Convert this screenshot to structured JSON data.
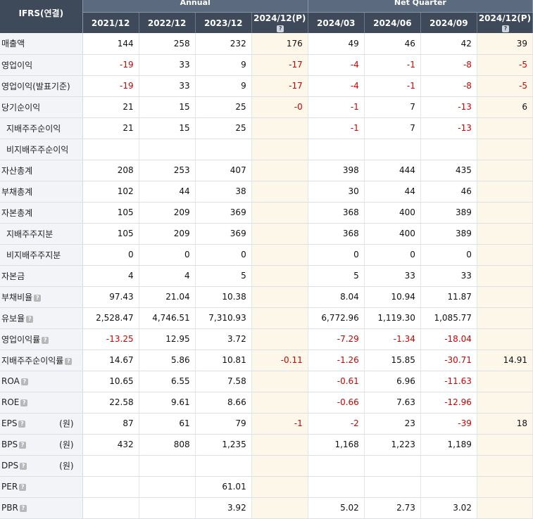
{
  "header": {
    "corner_label": "IFRS(연결)",
    "annual_label": "Annual",
    "quarter_label": "Net Quarter",
    "help_glyph": "?",
    "columns": [
      "2021/12",
      "2022/12",
      "2023/12",
      "2024/12(P)",
      "2024/03",
      "2024/06",
      "2024/09",
      "2024/12(P)"
    ],
    "estimate_columns": [
      3,
      7
    ],
    "columns_with_help": [
      3,
      7
    ]
  },
  "rows": [
    {
      "label": "매출액",
      "values": [
        "144",
        "258",
        "232",
        "176",
        "49",
        "46",
        "42",
        "39"
      ]
    },
    {
      "label": "영업이익",
      "values": [
        "-19",
        "33",
        "9",
        "-17",
        "-4",
        "-1",
        "-8",
        "-5"
      ]
    },
    {
      "label": "영업이익(발표기준)",
      "values": [
        "-19",
        "33",
        "9",
        "-17",
        "-4",
        "-1",
        "-8",
        "-5"
      ]
    },
    {
      "label": "당기순이익",
      "values": [
        "21",
        "15",
        "25",
        "-0",
        "-1",
        "7",
        "-13",
        "6"
      ]
    },
    {
      "label": "지배주주순이익",
      "sub": true,
      "values": [
        "21",
        "15",
        "25",
        "",
        "-1",
        "7",
        "-13",
        ""
      ]
    },
    {
      "label": "비지배주주순이익",
      "sub": true,
      "values": [
        "",
        "",
        "",
        "",
        "",
        "",
        "",
        ""
      ]
    },
    {
      "label": "자산총계",
      "values": [
        "208",
        "253",
        "407",
        "",
        "398",
        "444",
        "435",
        ""
      ]
    },
    {
      "label": "부채총계",
      "values": [
        "102",
        "44",
        "38",
        "",
        "30",
        "44",
        "46",
        ""
      ]
    },
    {
      "label": "자본총계",
      "values": [
        "105",
        "209",
        "369",
        "",
        "368",
        "400",
        "389",
        ""
      ]
    },
    {
      "label": "지배주주지분",
      "sub": true,
      "values": [
        "105",
        "209",
        "369",
        "",
        "368",
        "400",
        "389",
        ""
      ]
    },
    {
      "label": "비지배주주지분",
      "sub": true,
      "values": [
        "0",
        "0",
        "0",
        "",
        "0",
        "0",
        "0",
        ""
      ]
    },
    {
      "label": "자본금",
      "values": [
        "4",
        "4",
        "5",
        "",
        "5",
        "33",
        "33",
        ""
      ]
    },
    {
      "label": "부채비율",
      "help": true,
      "values": [
        "97.43",
        "21.04",
        "10.38",
        "",
        "8.04",
        "10.94",
        "11.87",
        ""
      ]
    },
    {
      "label": "유보율",
      "help": true,
      "values": [
        "2,528.47",
        "4,746.51",
        "7,310.93",
        "",
        "6,772.96",
        "1,119.30",
        "1,085.77",
        ""
      ]
    },
    {
      "label": "영업이익률",
      "help": true,
      "values": [
        "-13.25",
        "12.95",
        "3.72",
        "",
        "-7.29",
        "-1.34",
        "-18.04",
        ""
      ]
    },
    {
      "label": "지배주주순이익률",
      "help": true,
      "values": [
        "14.67",
        "5.86",
        "10.81",
        "-0.11",
        "-1.26",
        "15.85",
        "-30.71",
        "14.91"
      ]
    },
    {
      "label": "ROA",
      "help": true,
      "values": [
        "10.65",
        "6.55",
        "7.58",
        "",
        "-0.61",
        "6.96",
        "-11.63",
        ""
      ]
    },
    {
      "label": "ROE",
      "help": true,
      "values": [
        "22.58",
        "9.61",
        "8.66",
        "",
        "-0.66",
        "7.63",
        "-12.96",
        ""
      ]
    },
    {
      "label": "EPS",
      "help": true,
      "unit": "(원)",
      "values": [
        "87",
        "61",
        "79",
        "-1",
        "-2",
        "23",
        "-39",
        "18"
      ]
    },
    {
      "label": "BPS",
      "help": true,
      "unit": "(원)",
      "values": [
        "432",
        "808",
        "1,235",
        "",
        "1,168",
        "1,223",
        "1,189",
        ""
      ]
    },
    {
      "label": "DPS",
      "help": true,
      "unit": "(원)",
      "values": [
        "",
        "",
        "",
        "",
        "",
        "",
        "",
        ""
      ]
    },
    {
      "label": "PER",
      "help": true,
      "values": [
        "",
        "",
        "61.01",
        "",
        "",
        "",
        "",
        ""
      ]
    },
    {
      "label": "PBR",
      "help": true,
      "values": [
        "",
        "",
        "3.92",
        "",
        "5.02",
        "2.73",
        "3.02",
        ""
      ]
    }
  ]
}
